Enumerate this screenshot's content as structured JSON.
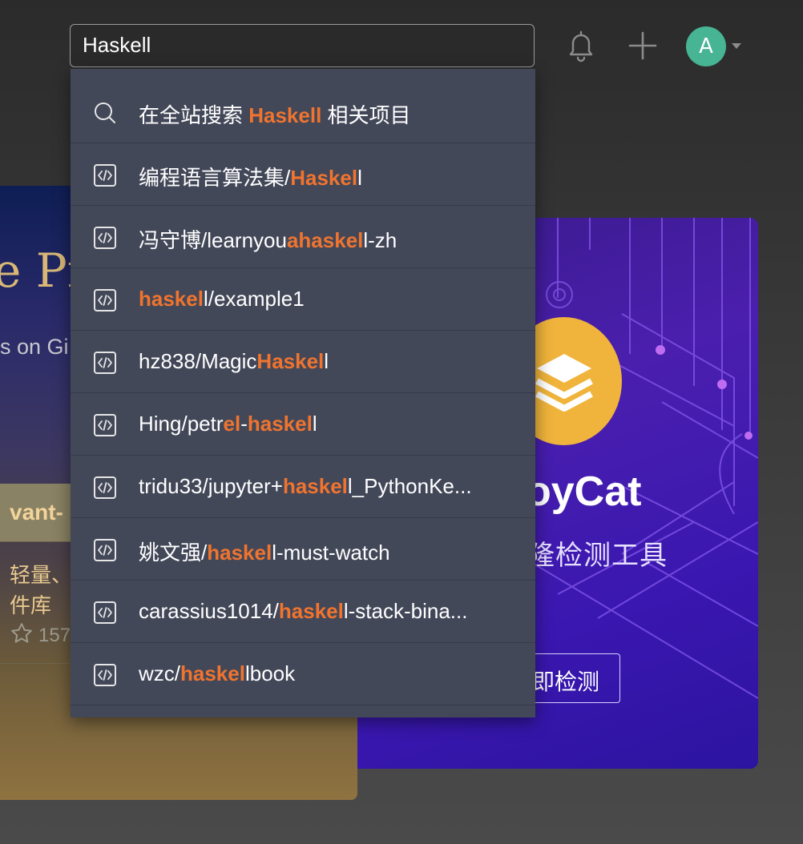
{
  "header": {
    "search": {
      "value": "Haskell",
      "placeholder": ""
    },
    "icons": [
      "bell-icon",
      "plus-icon"
    ],
    "avatar_letter": "A",
    "avatar_color": "#47b494"
  },
  "background": {
    "left_card": {
      "title_fragment": "e Pr",
      "subtitle_fragment": "s on Gi",
      "tag_fragment": "vant-",
      "desc_line1": "轻量、",
      "desc_line2": "件库",
      "stars_fragment": "157"
    },
    "right_card": {
      "title_fragment": "oyCat",
      "subtitle_fragment": "隆检测工具",
      "button_fragment": "即检测"
    }
  },
  "dropdown": {
    "highlight_color": "#f0742e",
    "site_search": {
      "prefix": "在全站搜索 ",
      "keyword": "Haskell",
      "suffix": " 相关项目",
      "icon": "search-icon"
    },
    "results": [
      {
        "icon": "code-icon",
        "segments": [
          {
            "t": "编程语言算法集/"
          },
          {
            "t": "Haskel",
            "hl": true
          },
          {
            "t": "l"
          }
        ]
      },
      {
        "icon": "code-icon",
        "segments": [
          {
            "t": "冯守博/learnyou"
          },
          {
            "t": "ahaskel",
            "hl": true
          },
          {
            "t": "l-zh"
          }
        ]
      },
      {
        "icon": "code-icon",
        "segments": [
          {
            "t": "haskel",
            "hl": true
          },
          {
            "t": "l/example1"
          }
        ]
      },
      {
        "icon": "code-icon",
        "segments": [
          {
            "t": "hz838/Magic"
          },
          {
            "t": "Haskel",
            "hl": true
          },
          {
            "t": "l"
          }
        ]
      },
      {
        "icon": "code-icon",
        "segments": [
          {
            "t": "Hing/petr"
          },
          {
            "t": "el",
            "hl": true
          },
          {
            "t": "-"
          },
          {
            "t": "haskel",
            "hl": true
          },
          {
            "t": "l"
          }
        ]
      },
      {
        "icon": "code-icon",
        "segments": [
          {
            "t": "tridu33/jupyter+"
          },
          {
            "t": "haskel",
            "hl": true
          },
          {
            "t": "l_PythonKe..."
          }
        ]
      },
      {
        "icon": "code-icon",
        "segments": [
          {
            "t": "姚文强/"
          },
          {
            "t": "haskel",
            "hl": true
          },
          {
            "t": "l-must-watch"
          }
        ]
      },
      {
        "icon": "code-icon",
        "segments": [
          {
            "t": "carassius1014/"
          },
          {
            "t": "haskel",
            "hl": true
          },
          {
            "t": "l-stack-bina..."
          }
        ]
      },
      {
        "icon": "code-icon",
        "segments": [
          {
            "t": "wzc/"
          },
          {
            "t": "haskel",
            "hl": true
          },
          {
            "t": "lbook"
          }
        ]
      }
    ]
  }
}
